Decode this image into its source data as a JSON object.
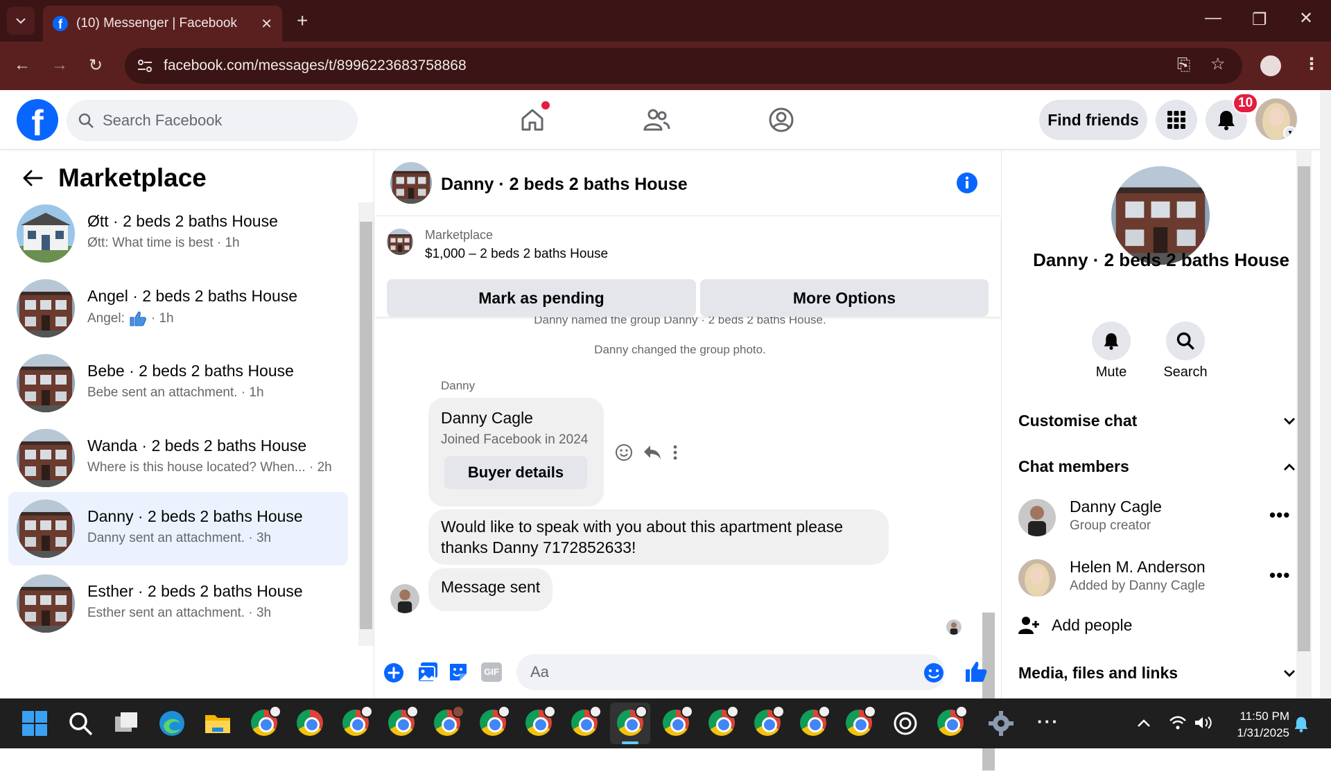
{
  "browser": {
    "tab_title": "(10) Messenger | Facebook",
    "url": "facebook.com/messages/t/8996223683758868"
  },
  "header": {
    "search_placeholder": "Search Facebook",
    "find_friends": "Find friends",
    "notification_count": "10"
  },
  "sidebar": {
    "title": "Marketplace",
    "conversations": [
      {
        "name": "Øtt · 2 beds 2 baths House",
        "preview": "Øtt: What time is best · 1h",
        "active": false
      },
      {
        "name": "Angel · 2 beds 2 baths House",
        "preview": "Angel:",
        "preview_suffix": "· 1h",
        "active": false
      },
      {
        "name": "Bebe · 2 beds 2 baths House",
        "preview": "Bebe sent an attachment. · 1h",
        "active": false
      },
      {
        "name": "Wanda · 2 beds 2 baths House",
        "preview": "Where is this house located? When... · 2h",
        "active": false
      },
      {
        "name": "Danny · 2 beds 2 baths House",
        "preview": "Danny sent an attachment. · 3h",
        "active": true
      },
      {
        "name": "Esther · 2 beds 2 baths House",
        "preview": "Esther sent an attachment. · 3h",
        "active": false
      }
    ]
  },
  "chat": {
    "title": "Danny · 2 beds 2 baths House",
    "listing_label": "Marketplace",
    "listing_title": "$1,000 – 2 beds 2 baths House",
    "mark_pending": "Mark as pending",
    "more_options": "More Options",
    "system_messages": [
      "Danny named the group Danny · 2 beds 2 baths House.",
      "Danny changed the group photo."
    ],
    "sender_label": "Danny",
    "card_name": "Danny Cagle",
    "card_sub": "Joined Facebook in 2024",
    "buyer_details": "Buyer details",
    "message_1": "Would like to speak with you about this apartment please thanks Danny 7172852633!",
    "message_2": "Message sent",
    "composer_placeholder": "Aa"
  },
  "details": {
    "name": "Danny · 2 beds 2 baths House",
    "mute": "Mute",
    "search": "Search",
    "customise_chat": "Customise chat",
    "chat_members": "Chat members",
    "members": [
      {
        "name": "Danny Cagle",
        "sub": "Group creator"
      },
      {
        "name": "Helen M. Anderson",
        "sub": "Added by Danny Cagle"
      }
    ],
    "add_people": "Add people",
    "media": "Media, files and links"
  },
  "taskbar": {
    "time": "11:50 PM",
    "date": "1/31/2025"
  },
  "colors": {
    "fb_blue": "#0866ff",
    "active_bg": "#ebf2fe",
    "badge_red": "#e41e3f",
    "chrome_dark": "#3b1515"
  }
}
